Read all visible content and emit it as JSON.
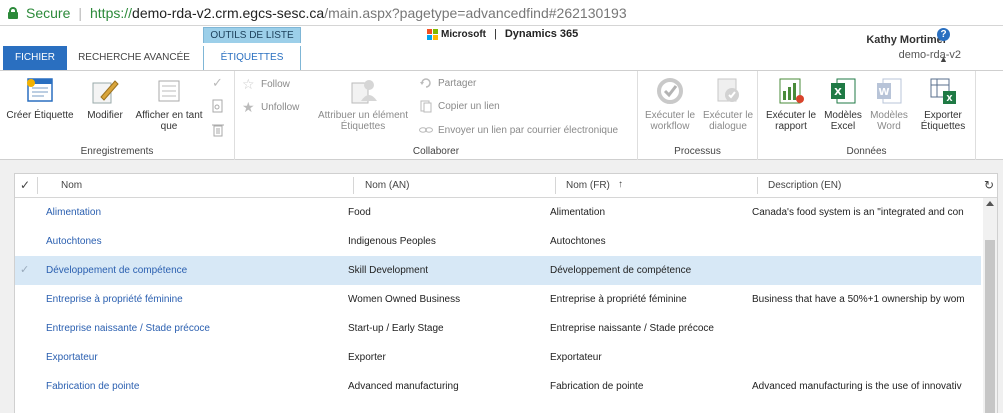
{
  "browser": {
    "secure_label": "Secure",
    "url_scheme": "https://",
    "url_host": "demo-rda-v2.crm.egcs-sesc.ca",
    "url_path": "/main.aspx?pagetype=advancedfind#262130193"
  },
  "header": {
    "tabs": [
      "FICHIER",
      "RECHERCHE AVANCÉE",
      "ÉTIQUETTES"
    ],
    "context_group": "OUTILS DE LISTE",
    "brand": "Microsoft",
    "product": "Dynamics 365",
    "user_name": "Kathy Mortimer",
    "org_name": "demo-rda-v2",
    "help_label": "?"
  },
  "ribbon": {
    "groups": [
      "Enregistrements",
      "Collaborer",
      "Processus",
      "Données"
    ],
    "enregistrements": {
      "create": "Créer Étiquette",
      "modify": "Modifier",
      "show_as_line1": "Afficher en tant",
      "show_as_line2": "que"
    },
    "collaborer": {
      "follow": "Follow",
      "unfollow": "Unfollow",
      "assign_line1": "Attribuer un élément",
      "assign_line2": "Étiquettes",
      "share": "Partager",
      "copy_link": "Copier un lien",
      "email_link": "Envoyer un lien par courrier électronique"
    },
    "processus": {
      "run_workflow_line1": "Exécuter le",
      "run_workflow_line2": "workflow",
      "run_dialog_line1": "Exécuter le",
      "run_dialog_line2": "dialogue"
    },
    "donnees": {
      "run_report_line1": "Exécuter le",
      "run_report_line2": "rapport",
      "excel_templates_line1": "Modèles",
      "excel_templates_line2": "Excel",
      "word_templates_line1": "Modèles",
      "word_templates_line2": "Word",
      "export_line1": "Exporter",
      "export_line2": "Étiquettes"
    }
  },
  "grid": {
    "columns": [
      "Nom",
      "Nom (AN)",
      "Nom (FR)",
      "Description (EN)"
    ],
    "sort_indicator": "↑",
    "rows": [
      {
        "name": "Alimentation",
        "an": "Food",
        "fr": "Alimentation",
        "en": "Canada's food system is an \"integrated and con"
      },
      {
        "name": "Autochtones",
        "an": "Indigenous Peoples",
        "fr": "Autochtones",
        "en": ""
      },
      {
        "name": "Développement de compétence",
        "an": "Skill Development",
        "fr": "Développement de compétence",
        "en": ""
      },
      {
        "name": "Entreprise à propriété féminine",
        "an": "Women Owned Business",
        "fr": "Entreprise à propriété féminine",
        "en": "Business that have a 50%+1 ownership by wom"
      },
      {
        "name": "Entreprise naissante / Stade précoce",
        "an": "Start-up / Early Stage",
        "fr": "Entreprise naissante / Stade précoce",
        "en": ""
      },
      {
        "name": "Exportateur",
        "an": "Exporter",
        "fr": "Exportateur",
        "en": ""
      },
      {
        "name": "Fabrication de pointe",
        "an": "Advanced manufacturing",
        "fr": "Fabrication de pointe",
        "en": "Advanced manufacturing is the use of innovativ"
      }
    ]
  },
  "colors": {
    "accent": "#2a6fc0",
    "selected_row": "#d7e8f6",
    "secure_green": "#2c8a3a",
    "context_tab": "#9ccfe9"
  },
  "icons": [
    "lock-icon",
    "microsoft-logo-icon",
    "help-icon",
    "create-record-icon",
    "edit-icon",
    "show-as-icon",
    "check-icon",
    "copy-page-icon",
    "delete-icon",
    "follow-star-icon",
    "unfollow-star-icon",
    "assign-icon",
    "share-icon",
    "copy-link-icon",
    "email-link-icon",
    "workflow-icon",
    "dialog-icon",
    "report-icon",
    "excel-icon",
    "word-icon",
    "export-excel-icon",
    "refresh-icon"
  ]
}
